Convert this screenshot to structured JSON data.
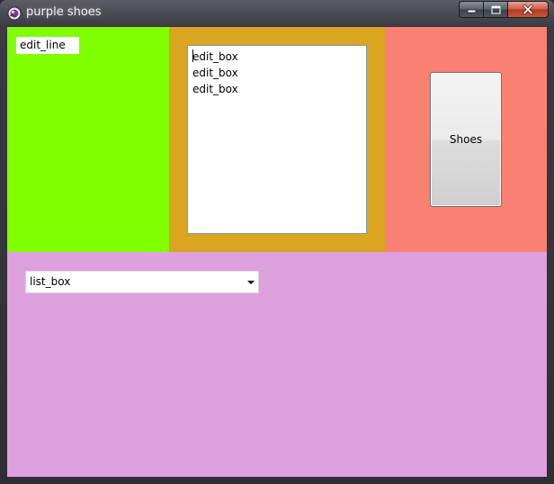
{
  "window": {
    "title": "purple shoes",
    "icon": "purple-shoes-app-icon",
    "controls": {
      "minimize": "minimize-icon",
      "maximize": "maximize-icon",
      "close": "close-icon"
    }
  },
  "colors": {
    "background": "#dda0dd",
    "left_pane": "#7fff00",
    "center_pane": "#daa520",
    "right_pane": "#fa8072"
  },
  "edit_line": {
    "value": "edit_line"
  },
  "edit_box": {
    "lines": [
      "edit_box",
      "edit_box",
      "edit_box"
    ]
  },
  "shoes_button": {
    "label": "Shoes"
  },
  "list_box": {
    "selected": "list_box",
    "arrow_icon": "dropdown-arrow-icon"
  }
}
